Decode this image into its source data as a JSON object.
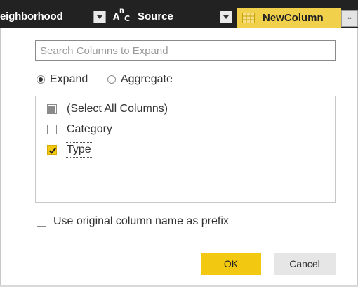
{
  "header": {
    "columns": [
      {
        "label": "eighborhood",
        "type_icon": "abc-text-icon"
      },
      {
        "label": "Source",
        "type_icon": "abc-text-icon"
      },
      {
        "label": "NewColumn",
        "type_icon": "table-icon"
      }
    ],
    "abc_icon": {
      "a": "A",
      "b": "B",
      "c": "C"
    },
    "expand_icon_glyph": "⇔",
    "highlight_color": "#f1d04b"
  },
  "dialog": {
    "search": {
      "placeholder": "Search Columns to Expand",
      "value": ""
    },
    "mode_options": [
      {
        "label": "Expand",
        "selected": true
      },
      {
        "label": "Aggregate",
        "selected": false
      }
    ],
    "columns": [
      {
        "label": "(Select All Columns)",
        "state": "partial"
      },
      {
        "label": "Category",
        "state": "unchecked"
      },
      {
        "label": "Type",
        "state": "checked"
      }
    ],
    "prefix": {
      "label": "Use original column name as prefix",
      "checked": false
    },
    "buttons": {
      "ok": "OK",
      "cancel": "Cancel"
    }
  },
  "colors": {
    "accent": "#f2c811",
    "header_bg": "#222222",
    "text": "#333333"
  }
}
